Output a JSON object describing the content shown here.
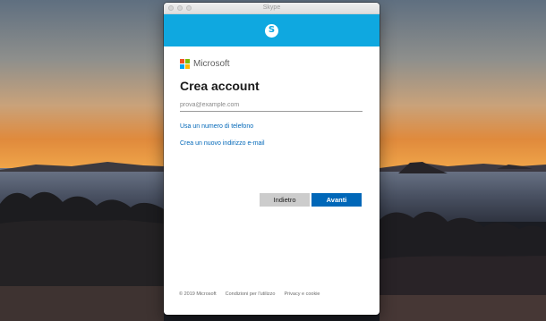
{
  "window": {
    "title": "Skype"
  },
  "header": {
    "logo_letter": "S",
    "logo_icon": "skype-icon"
  },
  "brand": {
    "name": "Microsoft",
    "logo_icon": "microsoft-logo-icon",
    "logo_colors": [
      "#f25022",
      "#7fba00",
      "#00a4ef",
      "#ffb900"
    ]
  },
  "form": {
    "heading": "Crea account",
    "email_placeholder": "prova@example.com",
    "email_value": "",
    "phone_link": "Usa un numero di telefono",
    "new_email_link": "Crea un nuovo indirizzo e-mail",
    "back_label": "Indietro",
    "next_label": "Avanti"
  },
  "footer": {
    "copyright": "© 2019 Microsoft",
    "terms": "Condizioni per l'utilizzo",
    "privacy": "Privacy e cookie"
  },
  "colors": {
    "header_blue": "#0fa8e0",
    "link_blue": "#0067b8",
    "primary_button": "#0067b8",
    "secondary_button": "#cccccc"
  }
}
